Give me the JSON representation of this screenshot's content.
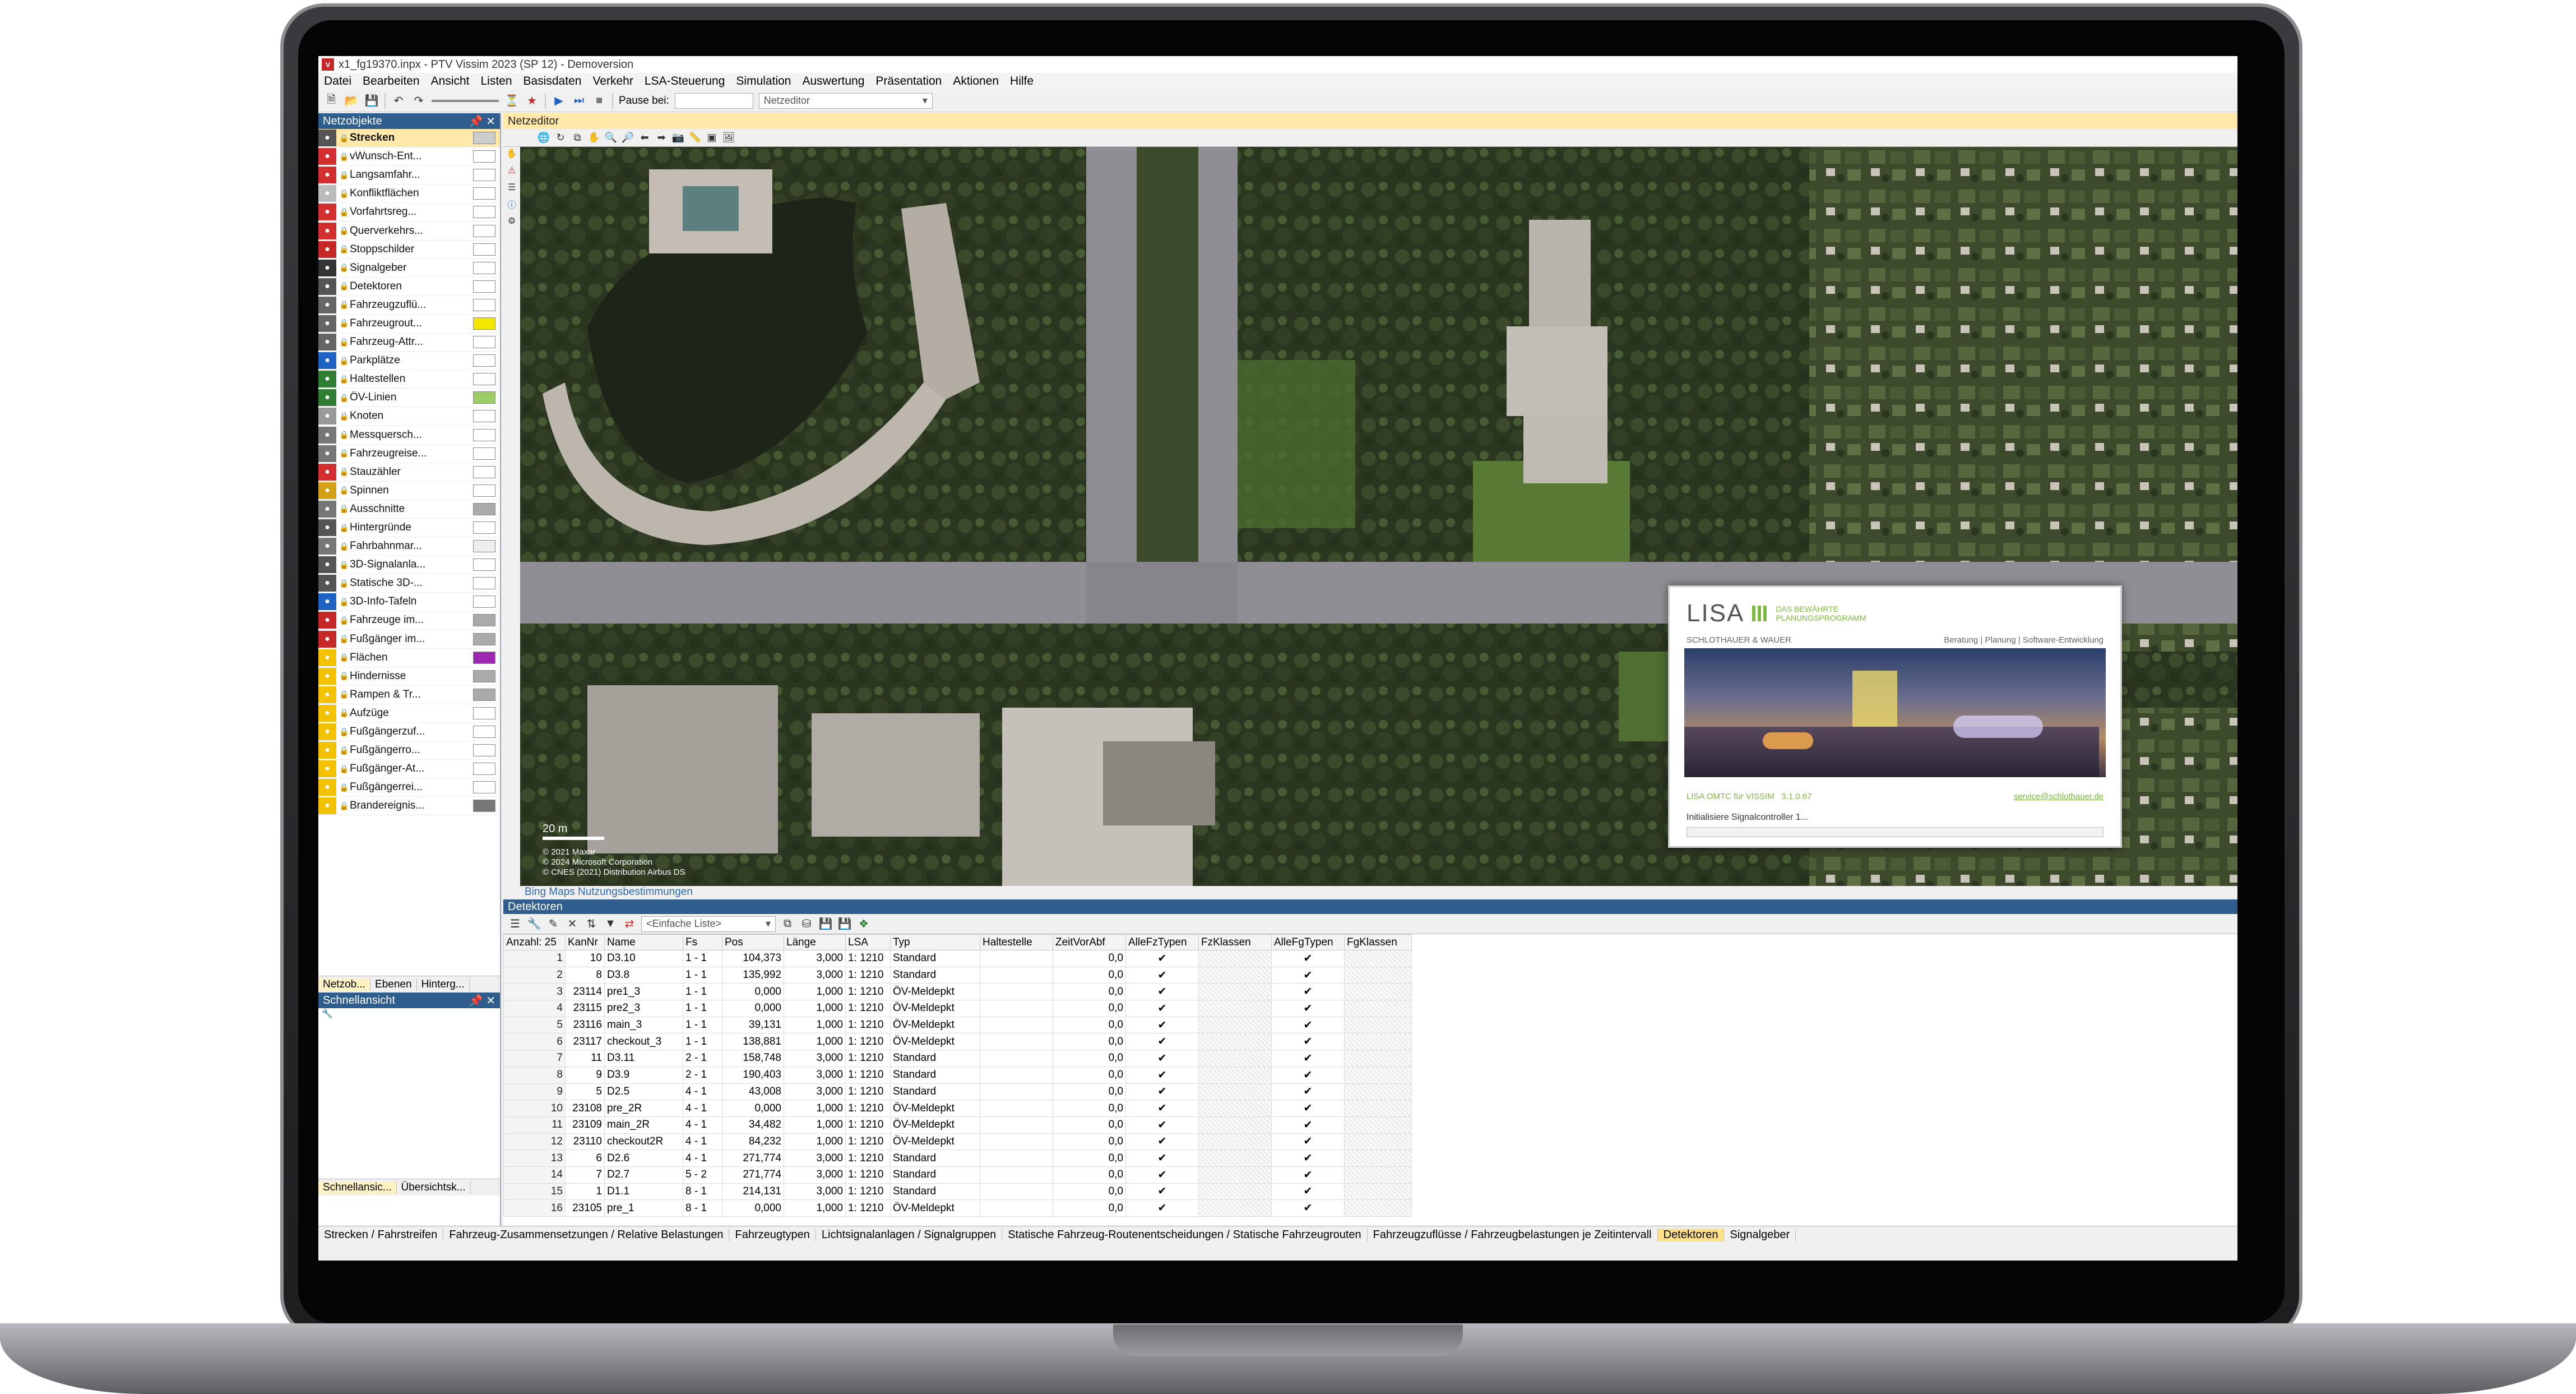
{
  "window": {
    "title": "x1_fg19370.inpx - PTV Vissim 2023 (SP 12) - Demoversion"
  },
  "menu": [
    "Datei",
    "Bearbeiten",
    "Ansicht",
    "Listen",
    "Basisdaten",
    "Verkehr",
    "LSA-Steuerung",
    "Simulation",
    "Auswertung",
    "Präsentation",
    "Aktionen",
    "Hilfe"
  ],
  "toolbar": {
    "pause_label": "Pause bei:",
    "pause_value": "",
    "editor_select": "Netzeditor"
  },
  "netobjects": {
    "title": "Netzobjekte",
    "items": [
      {
        "label": "Strecken",
        "icon": "road-icon",
        "color": "#555555",
        "swatch": "#cccccc"
      },
      {
        "label": "vWunsch-Ent...",
        "icon": "speed-icon",
        "color": "#d32f2f",
        "swatch": "#ffffff"
      },
      {
        "label": "Langsamfahr...",
        "icon": "slow-icon",
        "color": "#d32f2f",
        "swatch": "#ffffff"
      },
      {
        "label": "Konfliktflächen",
        "icon": "conflict-icon",
        "color": "#bbbbbb",
        "swatch": "#ffffff"
      },
      {
        "label": "Vorfahrtsreg...",
        "icon": "yield-icon",
        "color": "#d32f2f",
        "swatch": "#ffffff"
      },
      {
        "label": "Querverkehrs...",
        "icon": "crossing-icon",
        "color": "#d32f2f",
        "swatch": "#ffffff"
      },
      {
        "label": "Stoppschilder",
        "icon": "stop-icon",
        "color": "#c62828",
        "swatch": "#ffffff"
      },
      {
        "label": "Signalgeber",
        "icon": "signal-icon",
        "color": "#333333",
        "swatch": "#ffffff"
      },
      {
        "label": "Detektoren",
        "icon": "detector-icon",
        "color": "#555555",
        "swatch": "#ffffff"
      },
      {
        "label": "Fahrzeugzuflü...",
        "icon": "inflow-icon",
        "color": "#666666",
        "swatch": "#ffffff"
      },
      {
        "label": "Fahrzeugrout...",
        "icon": "route-icon",
        "color": "#666666",
        "swatch": "#f5e600"
      },
      {
        "label": "Fahrzeug-Attr...",
        "icon": "attr-icon",
        "color": "#666666",
        "swatch": "#ffffff"
      },
      {
        "label": "Parkplätze",
        "icon": "parking-icon",
        "color": "#1e63c4",
        "swatch": "#ffffff"
      },
      {
        "label": "Haltestellen",
        "icon": "busstop-icon",
        "color": "#2e7d32",
        "swatch": "#ffffff"
      },
      {
        "label": "ÖV-Linien",
        "icon": "transit-icon",
        "color": "#2e7d32",
        "swatch": "#9ccc65"
      },
      {
        "label": "Knoten",
        "icon": "node-icon",
        "color": "#999999",
        "swatch": "#ffffff"
      },
      {
        "label": "Messquersch...",
        "icon": "measure-icon",
        "color": "#777777",
        "swatch": "#ffffff"
      },
      {
        "label": "Fahrzeugreise...",
        "icon": "traveltime-icon",
        "color": "#777777",
        "swatch": "#ffffff"
      },
      {
        "label": "Stauzähler",
        "icon": "queue-icon",
        "color": "#d32f2f",
        "swatch": "#ffffff"
      },
      {
        "label": "Spinnen",
        "icon": "spider-icon",
        "color": "#d4a017",
        "swatch": "#ffffff"
      },
      {
        "label": "Ausschnitte",
        "icon": "section-icon",
        "color": "#777777",
        "swatch": "#aaaaaa"
      },
      {
        "label": "Hintergründe",
        "icon": "background-icon",
        "color": "#555555",
        "swatch": "#ffffff"
      },
      {
        "label": "Fahrbahnmar...",
        "icon": "marking-icon",
        "color": "#777777",
        "swatch": "#eeeeee"
      },
      {
        "label": "3D-Signalanla...",
        "icon": "3dsignal-icon",
        "color": "#555555",
        "swatch": "#ffffff"
      },
      {
        "label": "Statische 3D-...",
        "icon": "3dstatic-icon",
        "color": "#555555",
        "swatch": "#ffffff"
      },
      {
        "label": "3D-Info-Tafeln",
        "icon": "info-icon",
        "color": "#1e63c4",
        "swatch": "#ffffff"
      },
      {
        "label": "Fahrzeuge im...",
        "icon": "vehicle-icon",
        "color": "#c62828",
        "swatch": "#aaaaaa"
      },
      {
        "label": "Fußgänger im...",
        "icon": "pedestrian-icon",
        "color": "#c62828",
        "swatch": "#aaaaaa"
      },
      {
        "label": "Flächen",
        "icon": "area-icon",
        "color": "#f2c200",
        "swatch": "#9c27b0"
      },
      {
        "label": "Hindernisse",
        "icon": "obstacle-icon",
        "color": "#f2c200",
        "swatch": "#aaaaaa"
      },
      {
        "label": "Rampen & Tr...",
        "icon": "ramp-icon",
        "color": "#f2c200",
        "swatch": "#aaaaaa"
      },
      {
        "label": "Aufzüge",
        "icon": "elevator-icon",
        "color": "#f2c200",
        "swatch": "#ffffff"
      },
      {
        "label": "Fußgängerzuf...",
        "icon": "pedinflow-icon",
        "color": "#f2c200",
        "swatch": "#ffffff"
      },
      {
        "label": "Fußgängerro...",
        "icon": "pedroute-icon",
        "color": "#f2c200",
        "swatch": "#ffffff"
      },
      {
        "label": "Fußgänger-At...",
        "icon": "pedattr-icon",
        "color": "#f2c200",
        "swatch": "#ffffff"
      },
      {
        "label": "Fußgängerrei...",
        "icon": "pedtravel-icon",
        "color": "#f2c200",
        "swatch": "#ffffff"
      },
      {
        "label": "Brandereignis...",
        "icon": "fire-icon",
        "color": "#f2c200",
        "swatch": "#777777"
      }
    ],
    "tabs": [
      "Netzob...",
      "Ebenen",
      "Hinterg..."
    ]
  },
  "quickview": {
    "title": "Schnellansicht",
    "tabs": [
      "Schnellansic...",
      "Übersichtsk..."
    ]
  },
  "editor": {
    "title": "Netzeditor",
    "scale_label": "20 m",
    "copyright": [
      "© 2021 Maxar",
      "© 2024 Microsoft Corporation",
      "© CNES (2021) Distribution Airbus DS"
    ],
    "bing_link": "Bing Maps Nutzungsbestimmungen"
  },
  "splash": {
    "logo": "LISA",
    "tagline1": "DAS BEWÄHRTE",
    "tagline2": "PLANUNGSPROGRAMM",
    "company": "SCHLOTHAUER & WAUER",
    "services": "Beratung | Planung | Software-Entwicklung",
    "product": "LISA OMTC für VISSIM",
    "version": "3.1.0.67",
    "email": "service@schlothauer.de",
    "status": "Initialisiere Signalcontroller 1...",
    "progress": 0
  },
  "detectors": {
    "title": "Detektoren",
    "list_select": "<Einfache Liste>",
    "columns": [
      "Anzahl: 25",
      "KanNr",
      "Name",
      "Fs",
      "Pos",
      "Länge",
      "LSA",
      "Typ",
      "Haltestelle",
      "ZeitVorAbf",
      "AlleFzTypen",
      "FzKlassen",
      "AlleFgTypen",
      "FgKlassen"
    ],
    "rows": [
      [
        "1",
        "10",
        "D3.10",
        "1 - 1",
        "104,373",
        "3,000",
        "1: 1210",
        "Standard",
        "",
        "0,0"
      ],
      [
        "2",
        "8",
        "D3.8",
        "1 - 1",
        "135,992",
        "3,000",
        "1: 1210",
        "Standard",
        "",
        "0,0"
      ],
      [
        "3",
        "23114",
        "pre1_3",
        "1 - 1",
        "0,000",
        "1,000",
        "1: 1210",
        "ÖV-Meldepkt",
        "",
        "0,0"
      ],
      [
        "4",
        "23115",
        "pre2_3",
        "1 - 1",
        "0,000",
        "1,000",
        "1: 1210",
        "ÖV-Meldepkt",
        "",
        "0,0"
      ],
      [
        "5",
        "23116",
        "main_3",
        "1 - 1",
        "39,131",
        "1,000",
        "1: 1210",
        "ÖV-Meldepkt",
        "",
        "0,0"
      ],
      [
        "6",
        "23117",
        "checkout_3",
        "1 - 1",
        "138,881",
        "1,000",
        "1: 1210",
        "ÖV-Meldepkt",
        "",
        "0,0"
      ],
      [
        "7",
        "11",
        "D3.11",
        "2 - 1",
        "158,748",
        "3,000",
        "1: 1210",
        "Standard",
        "",
        "0,0"
      ],
      [
        "8",
        "9",
        "D3.9",
        "2 - 1",
        "190,403",
        "3,000",
        "1: 1210",
        "Standard",
        "",
        "0,0"
      ],
      [
        "9",
        "5",
        "D2.5",
        "4 - 1",
        "43,008",
        "3,000",
        "1: 1210",
        "Standard",
        "",
        "0,0"
      ],
      [
        "10",
        "23108",
        "pre_2R",
        "4 - 1",
        "0,000",
        "1,000",
        "1: 1210",
        "ÖV-Meldepkt",
        "",
        "0,0"
      ],
      [
        "11",
        "23109",
        "main_2R",
        "4 - 1",
        "34,482",
        "1,000",
        "1: 1210",
        "ÖV-Meldepkt",
        "",
        "0,0"
      ],
      [
        "12",
        "23110",
        "checkout2R",
        "4 - 1",
        "84,232",
        "1,000",
        "1: 1210",
        "ÖV-Meldepkt",
        "",
        "0,0"
      ],
      [
        "13",
        "6",
        "D2.6",
        "4 - 1",
        "271,774",
        "3,000",
        "1: 1210",
        "Standard",
        "",
        "0,0"
      ],
      [
        "14",
        "7",
        "D2.7",
        "5 - 2",
        "271,774",
        "3,000",
        "1: 1210",
        "Standard",
        "",
        "0,0"
      ],
      [
        "15",
        "1",
        "D1.1",
        "8 - 1",
        "214,131",
        "3,000",
        "1: 1210",
        "Standard",
        "",
        "0,0"
      ],
      [
        "16",
        "23105",
        "pre_1",
        "8 - 1",
        "0,000",
        "1,000",
        "1: 1210",
        "ÖV-Meldepkt",
        "",
        "0,0"
      ]
    ]
  },
  "bottom_tabs": [
    "Strecken / Fahrstreifen",
    "Fahrzeug-Zusammensetzungen / Relative Belastungen",
    "Fahrzeugtypen",
    "Lichtsignalanlagen / Signalgruppen",
    "Statische Fahrzeug-Routenentscheidungen / Statische Fahrzeugrouten",
    "Fahrzeugzuflüsse / Fahrzeugbelastungen je Zeitintervall",
    "Detektoren",
    "Signalgeber"
  ],
  "active_bottom_tab": "Detektoren",
  "colors": {
    "panel_header": "#2e5d8e",
    "editor_header": "#ffe8a8",
    "active_tab": "#ffe08a",
    "lisa_green": "#7bb93f"
  }
}
